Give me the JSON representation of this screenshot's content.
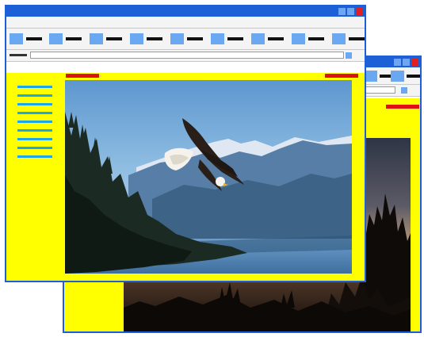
{
  "windows": {
    "back": {
      "title": "",
      "image": "sunset-silhouette-photo"
    },
    "front": {
      "title": "",
      "image": "bald-eagle-photo",
      "toolbar_buttons": 9,
      "sidebar_links": 9
    }
  },
  "colors": {
    "titlebar": "#1c5fd6",
    "page_background": "#ffff00",
    "toolbar_button": "#6aa8f2",
    "sidebar_link": "#1fa6e6",
    "header_tab": "#e01010",
    "close_button": "#e02020"
  },
  "icons": {
    "minimize": "minimize-icon",
    "maximize": "maximize-icon",
    "close": "close-icon"
  }
}
